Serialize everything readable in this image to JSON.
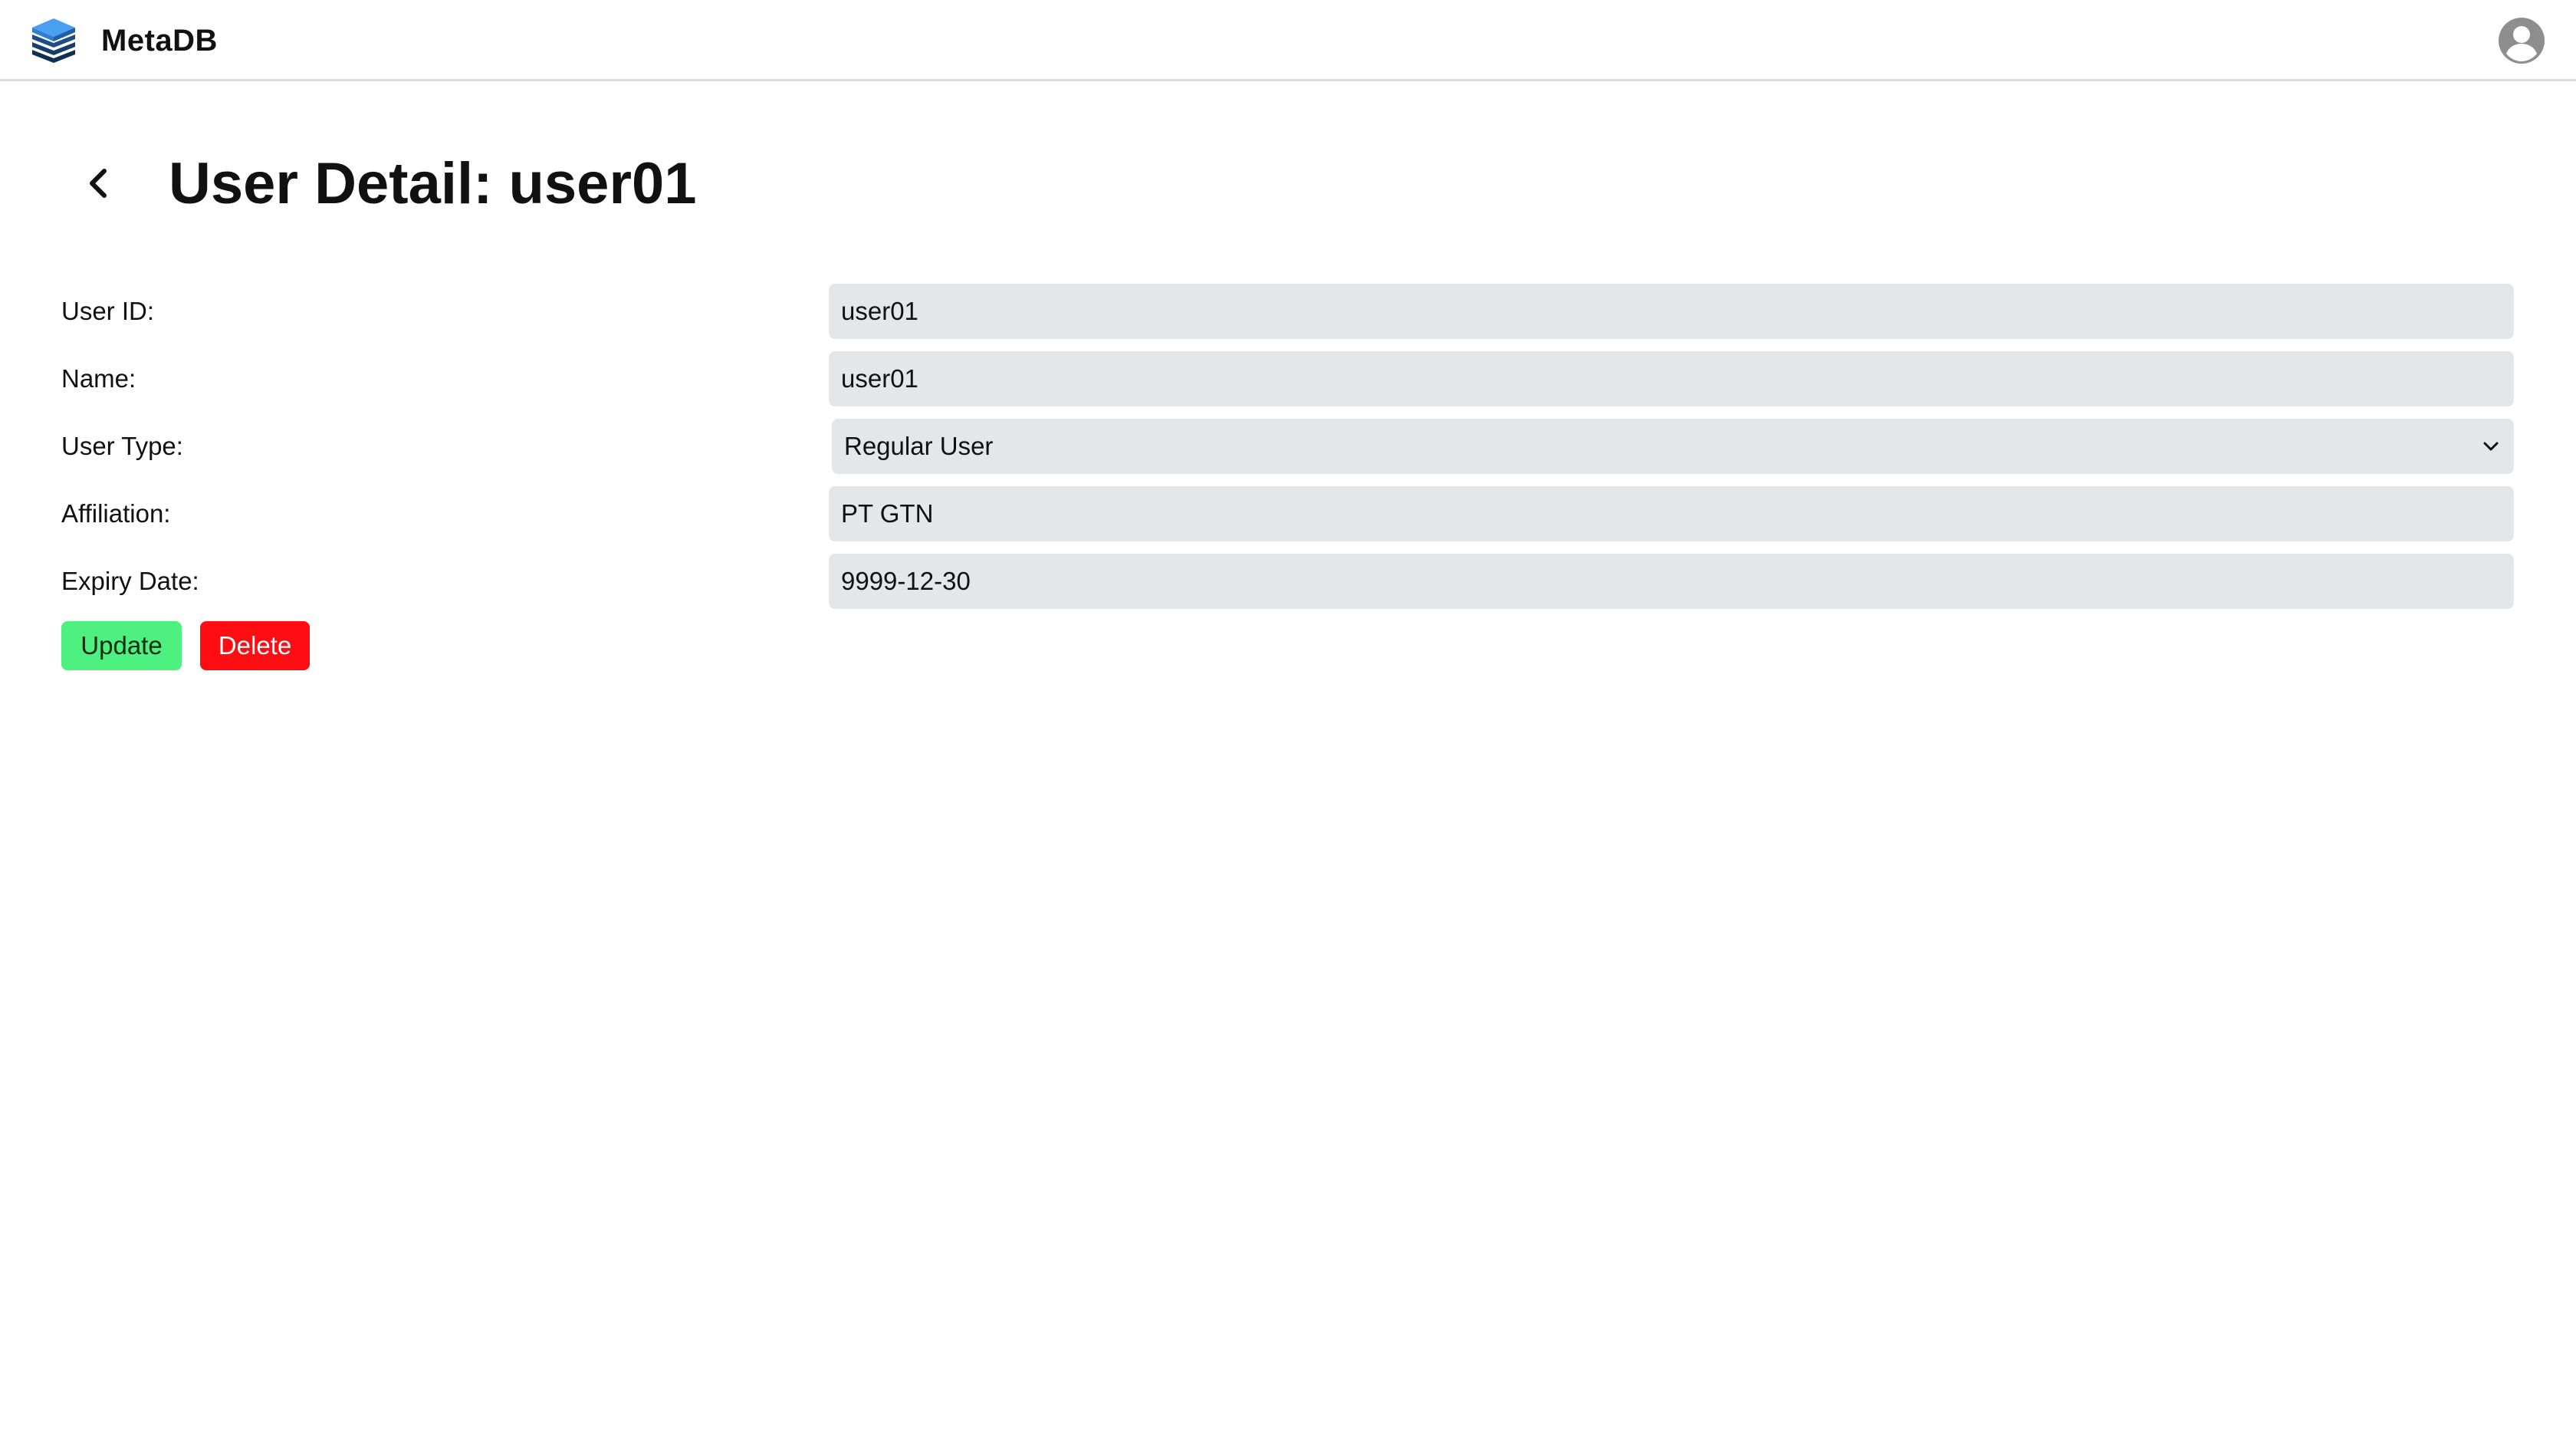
{
  "header": {
    "brand": "MetaDB",
    "logo_icon": "stacked-layers-icon",
    "avatar_icon": "user-avatar-icon"
  },
  "page": {
    "title": "User Detail: user01",
    "back_icon": "chevron-left-icon"
  },
  "form": {
    "user_id": {
      "label": "User ID:",
      "value": "user01"
    },
    "name": {
      "label": "Name:",
      "value": "user01"
    },
    "user_type": {
      "label": "User Type:",
      "value": "Regular User"
    },
    "affiliation": {
      "label": "Affiliation:",
      "value": "PT GTN"
    },
    "expiry_date": {
      "label": "Expiry Date:",
      "value": "9999-12-30"
    }
  },
  "actions": {
    "update_label": "Update",
    "delete_label": "Delete"
  },
  "colors": {
    "field_bg": "#e5e6ea",
    "update_bg": "#4ef07f",
    "delete_bg": "#ff0d12",
    "logo_blue": "#3b8fe6",
    "logo_dark": "#123a63"
  }
}
